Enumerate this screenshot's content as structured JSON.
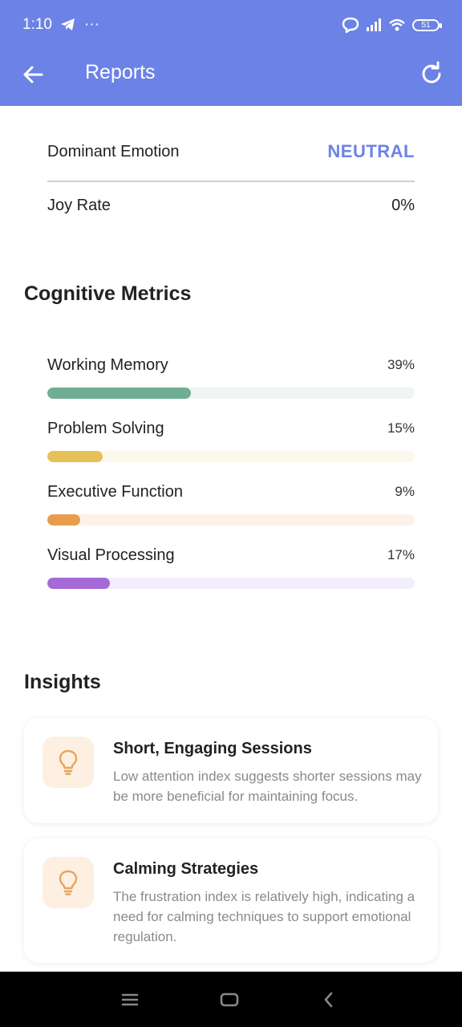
{
  "status_bar": {
    "time": "1:10",
    "more": "···",
    "battery": "51"
  },
  "header": {
    "title": "Reports"
  },
  "summary": {
    "dominant_label": "Dominant Emotion",
    "dominant_value": "NEUTRAL",
    "joy_label": "Joy Rate",
    "joy_value": "0%"
  },
  "cognitive": {
    "title": "Cognitive Metrics",
    "metrics": [
      {
        "label": "Working Memory",
        "value_text": "39%",
        "value": 39,
        "color": "#6fae94",
        "track": "#eef5f2"
      },
      {
        "label": "Problem Solving",
        "value_text": "15%",
        "value": 15,
        "color": "#e8c05a",
        "track": "#fcf8ec"
      },
      {
        "label": "Executive Function",
        "value_text": "9%",
        "value": 9,
        "color": "#e89d4c",
        "track": "#fdf2e8"
      },
      {
        "label": "Visual Processing",
        "value_text": "17%",
        "value": 17,
        "color": "#a56ad6",
        "track": "#f3eefb"
      }
    ]
  },
  "insights": {
    "title": "Insights",
    "cards": [
      {
        "title": "Short, Engaging Sessions",
        "text": "Low attention index suggests shorter sessions may be more beneficial for maintaining focus.",
        "icon": "lightbulb-icon"
      },
      {
        "title": "Calming Strategies",
        "text": "The frustration index is relatively high, indicating a need for calming techniques to support emotional regulation.",
        "icon": "lightbulb-icon"
      }
    ]
  },
  "colors": {
    "accent": "#6b82e6",
    "icon": "#e8a45c"
  }
}
